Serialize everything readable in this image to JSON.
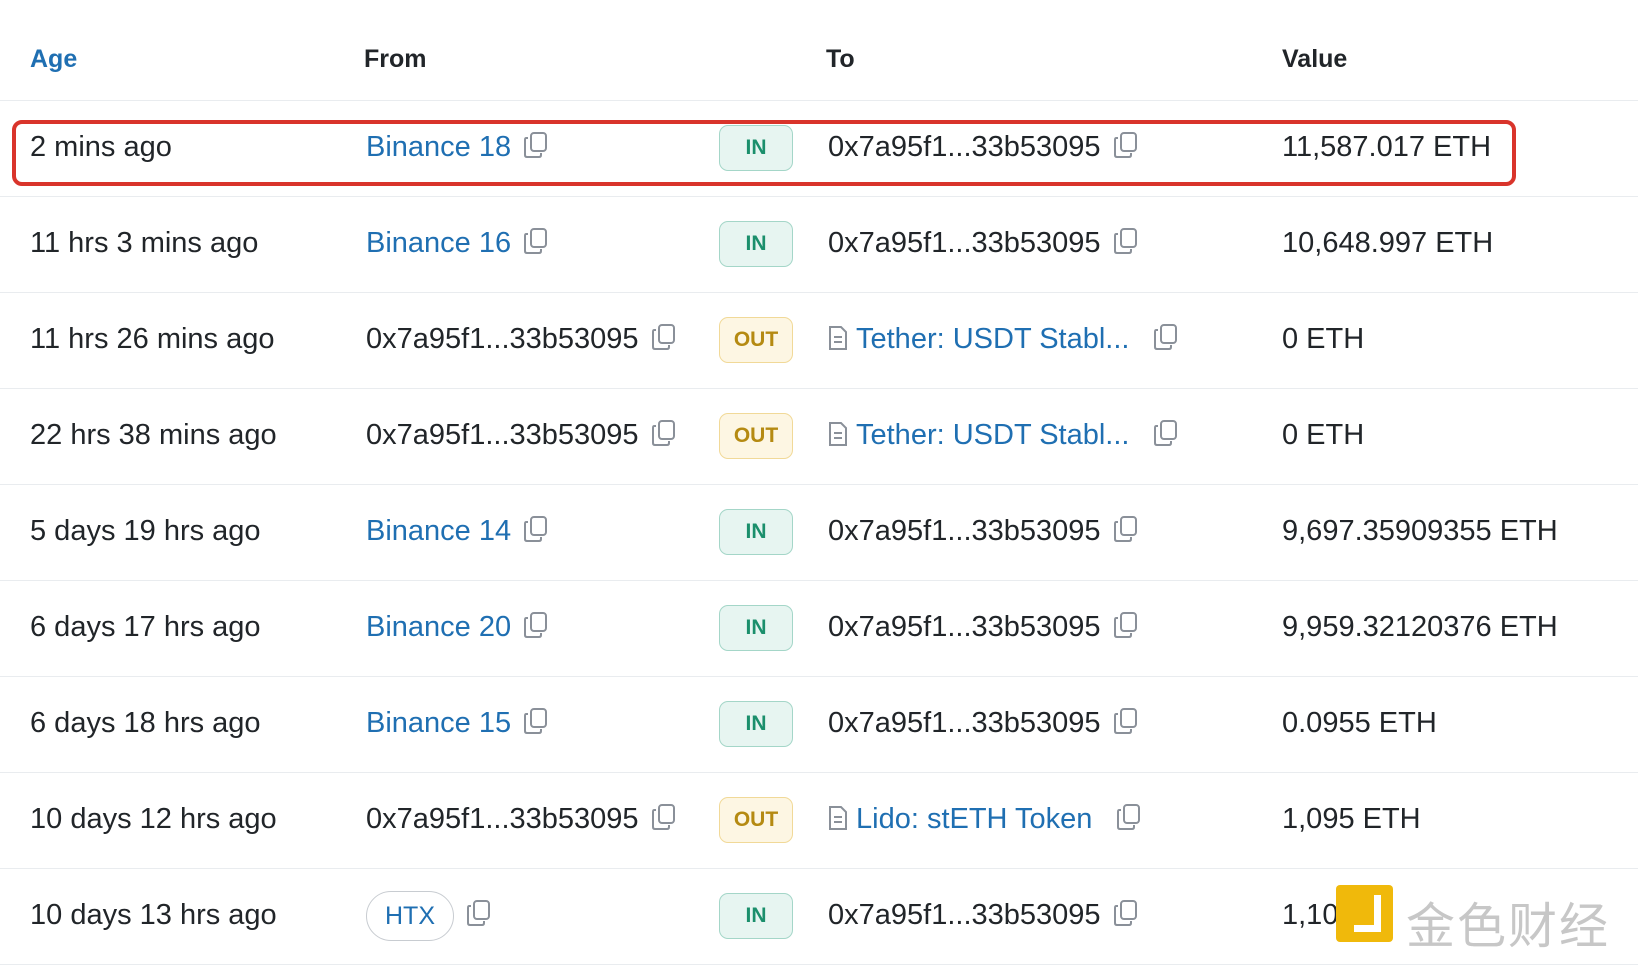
{
  "header": {
    "age": "Age",
    "from": "From",
    "to": "To",
    "value": "Value"
  },
  "rows": [
    {
      "age": "2 mins ago",
      "from": "Binance 18",
      "from_type": "link",
      "dir": "IN",
      "to": "0x7a95f1...33b53095",
      "to_type": "address",
      "value": "11,587.017 ETH"
    },
    {
      "age": "11 hrs 3 mins ago",
      "from": "Binance 16",
      "from_type": "link",
      "dir": "IN",
      "to": "0x7a95f1...33b53095",
      "to_type": "address",
      "value": "10,648.997 ETH"
    },
    {
      "age": "11 hrs 26 mins ago",
      "from": "0x7a95f1...33b53095",
      "from_type": "address",
      "dir": "OUT",
      "to": "Tether: USDT Stabl...",
      "to_type": "contract",
      "value": "0 ETH"
    },
    {
      "age": "22 hrs 38 mins ago",
      "from": "0x7a95f1...33b53095",
      "from_type": "address",
      "dir": "OUT",
      "to": "Tether: USDT Stabl...",
      "to_type": "contract",
      "value": "0 ETH"
    },
    {
      "age": "5 days 19 hrs ago",
      "from": "Binance 14",
      "from_type": "link",
      "dir": "IN",
      "to": "0x7a95f1...33b53095",
      "to_type": "address",
      "value": "9,697.35909355 ETH"
    },
    {
      "age": "6 days 17 hrs ago",
      "from": "Binance 20",
      "from_type": "link",
      "dir": "IN",
      "to": "0x7a95f1...33b53095",
      "to_type": "address",
      "value": "9,959.32120376 ETH"
    },
    {
      "age": "6 days 18 hrs ago",
      "from": "Binance 15",
      "from_type": "link",
      "dir": "IN",
      "to": "0x7a95f1...33b53095",
      "to_type": "address",
      "value": "0.0955 ETH"
    },
    {
      "age": "10 days 12 hrs ago",
      "from": "0x7a95f1...33b53095",
      "from_type": "address",
      "dir": "OUT",
      "to": "Lido: stETH Token",
      "to_type": "contract",
      "value": "1,095 ETH"
    },
    {
      "age": "10 days 13 hrs ago",
      "from": "HTX",
      "from_type": "pill",
      "dir": "IN",
      "to": "0x7a95f1...33b53095",
      "to_type": "address",
      "value": "1,10..."
    }
  ],
  "watermark": {
    "text": "金色财经",
    "logo_color": "#f0b90b"
  },
  "colors": {
    "link": "#1f6fb2",
    "in": "#1b8f6c",
    "out": "#b58a12",
    "highlight": "#d9342b"
  }
}
